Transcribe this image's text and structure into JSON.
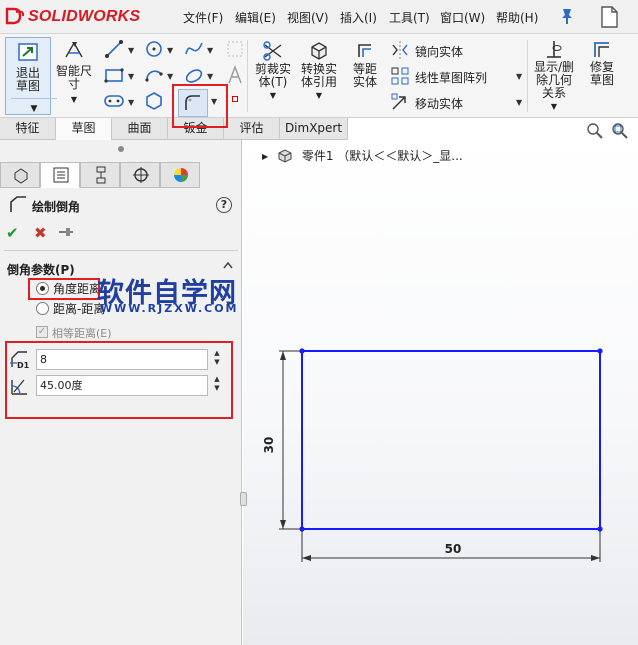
{
  "app": {
    "logo_text": "SOLIDWORKS"
  },
  "menu": [
    "文件(F)",
    "编辑(E)",
    "视图(V)",
    "插入(I)",
    "工具(T)",
    "窗口(W)",
    "帮助(H)"
  ],
  "ribbon": {
    "exit_sketch": "退出草图",
    "smart_dim": "智能尺寸",
    "trim": "剪裁实体(T)",
    "convert": "转换实体引用",
    "offset": "等距实体",
    "mirror": "镜向实体",
    "linear_pattern": "线性草图阵列",
    "move": "移动实体",
    "relations": "显示/删除几何关系",
    "repair": "修复草图"
  },
  "tabs": [
    "特征",
    "草图",
    "曲面",
    "钣金",
    "评估",
    "DimXpert"
  ],
  "tree": {
    "part": "零件1 （默认＜＜默认＞_显..."
  },
  "panel": {
    "title": "绘制倒角",
    "group": "倒角参数(P)",
    "opt_angle": "角度距离",
    "opt_distance": "距离-距离",
    "equal_distance": "相等距离(E)",
    "distance_value": "8",
    "angle_value": "45.00度",
    "d1_label": "D1"
  },
  "watermark": {
    "cn": "软件自学网",
    "en": "WWW.RJZXW.COM"
  },
  "drawing": {
    "height_dim": "30",
    "width_dim": "50"
  },
  "colors": {
    "sketch": "#1a1aff",
    "highlight": "#e02020",
    "brand": "#d71920",
    "watermark": "#1f3fa3"
  }
}
